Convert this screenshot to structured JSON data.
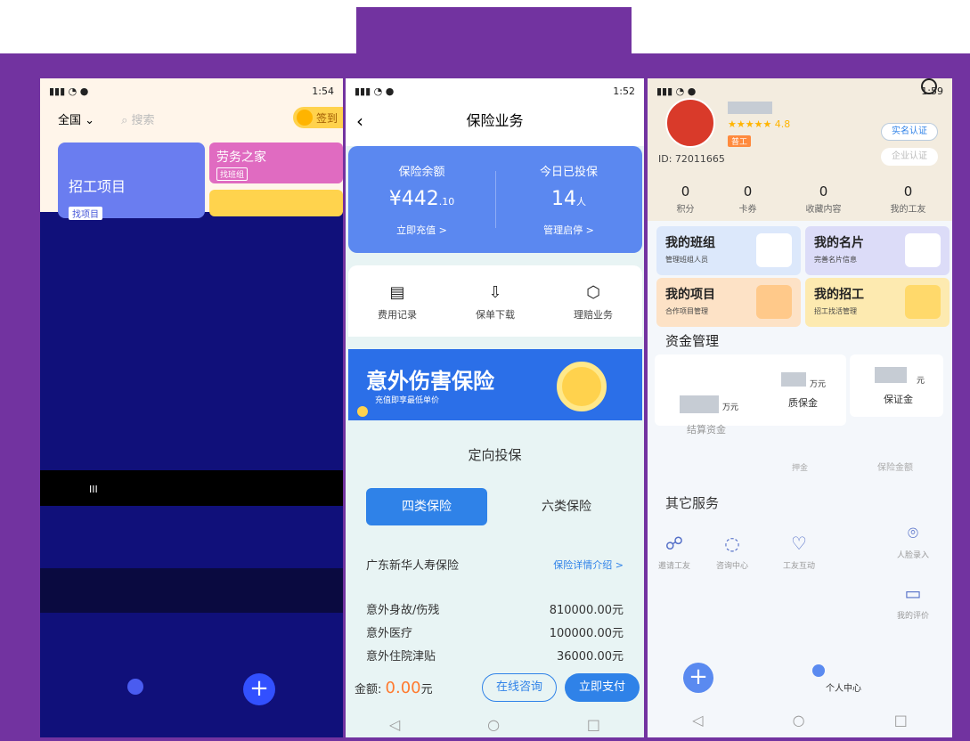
{
  "screen1": {
    "status_time": "1:54",
    "region": "全国",
    "search_placeholder": "搜索",
    "checkin": "签到",
    "card_recruit": "招工项目",
    "card_recruit_btn": "找项目",
    "card_labor": "劳务之家",
    "card_labor_btn": "找班组",
    "glitch_text": "III"
  },
  "screen2": {
    "status_time": "1:52",
    "title": "保险业务",
    "balance_label": "保险余额",
    "balance_value": "¥442",
    "balance_decimal": ".10",
    "recharge": "立即充值 >",
    "today_label": "今日已投保",
    "today_value": "14",
    "today_unit": "人",
    "manage": "管理启停 >",
    "menu": [
      "费用记录",
      "保单下载",
      "理赔业务"
    ],
    "banner_title": "意外伤害保险",
    "banner_sub": "充值即享最低单价",
    "section_title": "定向投保",
    "tab_active": "四类保险",
    "tab_inactive": "六类保险",
    "company": "广东新华人寿保险",
    "detail_link": "保险详情介绍 >",
    "coverage": [
      {
        "name": "意外身故/伤残",
        "amount": "810000.00元"
      },
      {
        "name": "意外医疗",
        "amount": "100000.00元"
      },
      {
        "name": "意外住院津贴",
        "amount": "36000.00元"
      }
    ],
    "amount_label": "金额:",
    "amount_value": "0.00",
    "amount_unit": "元",
    "btn_consult": "在线咨询",
    "btn_pay": "立即支付"
  },
  "screen3": {
    "status_time": "1:59",
    "rating": "★★★★★ 4.8",
    "tag": "普工",
    "btn_real": "实名认证",
    "btn_ent": "企业认证",
    "uid": "ID: 72011665",
    "stats": [
      {
        "n": "0",
        "l": "积分"
      },
      {
        "n": "0",
        "l": "卡券"
      },
      {
        "n": "0",
        "l": "收藏内容"
      },
      {
        "n": "0",
        "l": "我的工友"
      }
    ],
    "tiles": [
      {
        "t": "我的班组",
        "s": "管理班组人员"
      },
      {
        "t": "我的名片",
        "s": "完善名片信息"
      },
      {
        "t": "我的项目",
        "s": "合作项目管理"
      },
      {
        "t": "我的招工",
        "s": "招工找活管理"
      }
    ],
    "fund_title": "资金管理",
    "fund_unit_wan": "万元",
    "fund_unit_yuan": "元",
    "fund_quality": "质保金",
    "fund_deposit": "保证金",
    "fund_settle": "结算资金",
    "fund_ins": "保险金额",
    "fund_other": "押金",
    "other_title": "其它服务",
    "services": [
      "邀请工友",
      "咨询中心",
      "工友互动",
      "人脸录入",
      "我的评价"
    ],
    "me_label": "个人中心",
    "colors": {
      "frame": "#7233a0",
      "accent": "#2f82e8"
    }
  }
}
